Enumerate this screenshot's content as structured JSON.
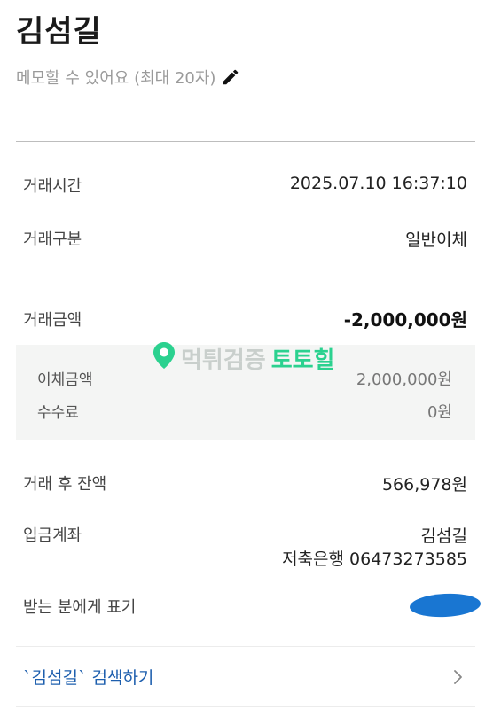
{
  "header": {
    "name": "김섬길",
    "memo_placeholder": "메모할 수 있어요 (최대 20자)"
  },
  "details": {
    "time_label": "거래시간",
    "time_value": "2025.07.10 16:37:10",
    "type_label": "거래구분",
    "type_value": "일반이체",
    "amount_label": "거래금액",
    "amount_value": "-2,000,000원",
    "transfer_amount_label": "이체금액",
    "transfer_amount_value": "2,000,000원",
    "fee_label": "수수료",
    "fee_value": "0원",
    "balance_label": "거래 후 잔액",
    "balance_value": "566,978원",
    "account_label": "입금계좌",
    "account_holder": "김섬길",
    "account_bank_number": "저축은행 06473273585",
    "display_label": "받는 분에게 표기"
  },
  "watermark": {
    "gray_text": "먹튀검증",
    "green_text": "토토힐"
  },
  "footer": {
    "search_link": "`김섬길` 검색하기"
  },
  "colors": {
    "accent_link": "#1e5fae",
    "watermark_green": "#2bd18f",
    "redaction_blue": "#1976d2"
  }
}
